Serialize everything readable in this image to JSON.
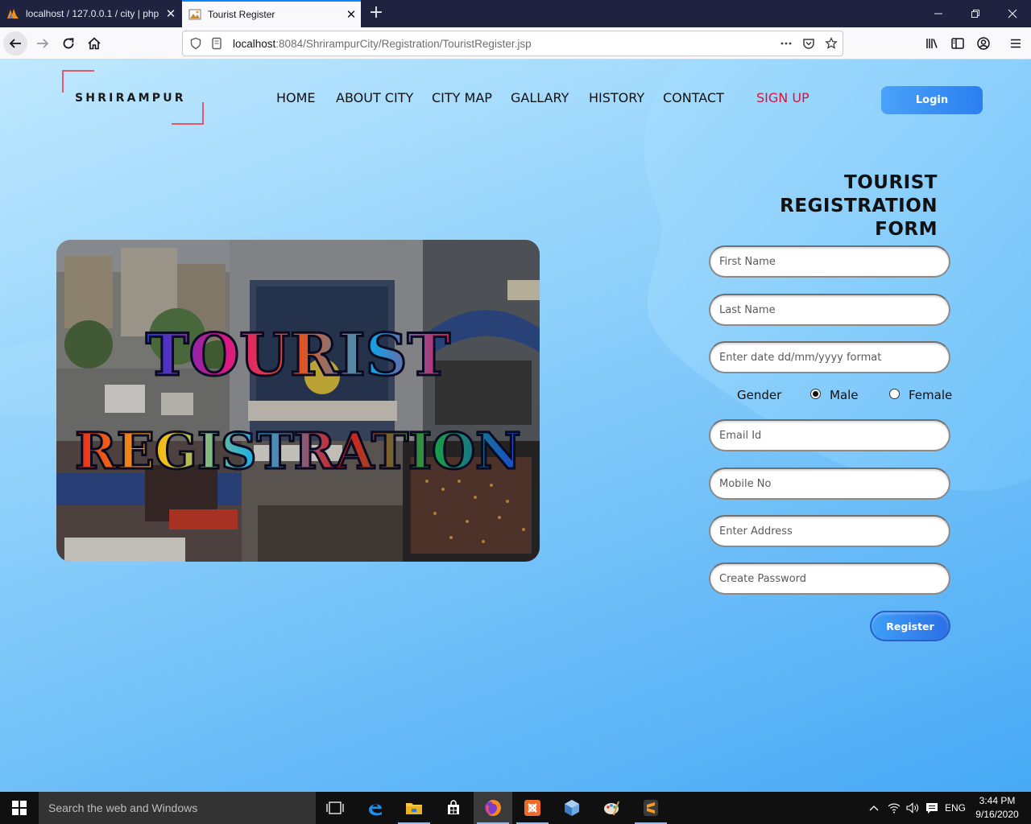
{
  "browser": {
    "tabs": [
      {
        "title": "localhost / 127.0.0.1 / city | php",
        "active": false
      },
      {
        "title": "Tourist Register",
        "active": true
      }
    ],
    "url_host": "localhost",
    "url_path": ":8084/ShrirampurCity/Registration/TouristRegister.jsp"
  },
  "site": {
    "logo": "SHRIRAMPUR",
    "nav": [
      "HOME",
      "ABOUT CITY",
      "CITY MAP",
      "GALLARY",
      "HISTORY",
      "CONTACT",
      "SIGN UP"
    ],
    "login": "Login",
    "hero_line1": "TOURIST",
    "hero_line2": "REGISTRATION"
  },
  "form": {
    "title_line1": "TOURIST REGISTRATION",
    "title_line2": "FORM",
    "first_name_ph": "First Name",
    "last_name_ph": "Last Name",
    "dob_ph": "Enter date dd/mm/yyyy format",
    "gender_label": "Gender",
    "gender_options": [
      "Male",
      "Female"
    ],
    "gender_selected": "Male",
    "email_ph": "Email Id",
    "mobile_ph": "Mobile No",
    "address_ph": "Enter Address",
    "password_ph": "Create Password",
    "register": "Register"
  },
  "taskbar": {
    "search": "Search the web and Windows",
    "lang": "ENG",
    "time": "3:44 PM",
    "date": "9/16/2020"
  },
  "colors": {
    "accent": "#2a7ff0",
    "signup": "#e0103a",
    "logo_corner": "#e05a6a",
    "tab_active_line": "#0a84ff"
  }
}
